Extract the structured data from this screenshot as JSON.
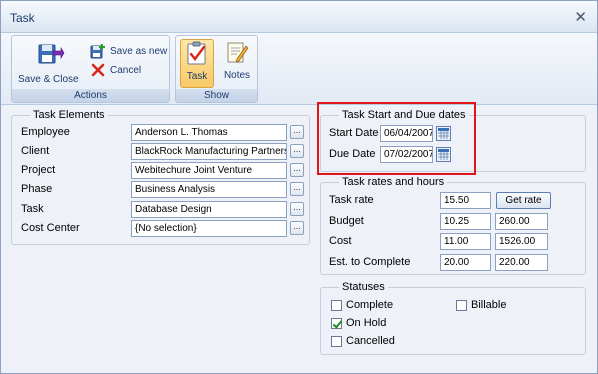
{
  "window": {
    "title": "Task"
  },
  "ribbon": {
    "actions": {
      "label": "Actions",
      "save_close": "Save & Close",
      "save_as_new": "Save as new",
      "cancel": "Cancel"
    },
    "show": {
      "label": "Show",
      "task": "Task",
      "notes": "Notes"
    }
  },
  "task_elements": {
    "title": "Task Elements",
    "rows": [
      {
        "label": "Employee",
        "value": "Anderson L. Thomas"
      },
      {
        "label": "Client",
        "value": "BlackRock Manufacturing Partners, Inc."
      },
      {
        "label": "Project",
        "value": "Webitechure Joint Venture"
      },
      {
        "label": "Phase",
        "value": "Business Analysis"
      },
      {
        "label": "Task",
        "value": "Database Design"
      },
      {
        "label": "Cost Center",
        "value": "{No selection}"
      }
    ],
    "browse_label": "..."
  },
  "dates": {
    "title": "Task Start and Due dates",
    "start_label": "Start Date",
    "start_value": "06/04/2007",
    "due_label": "Due Date",
    "due_value": "07/02/2007"
  },
  "rates": {
    "title": "Task rates and hours",
    "task_rate_label": "Task rate",
    "task_rate_value": "15.50",
    "get_rate": "Get rate",
    "budget_label": "Budget",
    "budget_a": "10.25",
    "budget_b": "260.00",
    "cost_label": "Cost",
    "cost_a": "11.00",
    "cost_b": "1526.00",
    "est_label": "Est. to Complete",
    "est_a": "20.00",
    "est_b": "220.00"
  },
  "statuses": {
    "title": "Statuses",
    "complete": {
      "label": "Complete",
      "checked": false
    },
    "billable": {
      "label": "Billable",
      "checked": false
    },
    "on_hold": {
      "label": "On Hold",
      "checked": true
    },
    "cancelled": {
      "label": "Cancelled",
      "checked": false
    }
  },
  "colors": {
    "highlight": "#e0161b",
    "title_text": "#1e3c6e",
    "accent_active": "#f8c966"
  }
}
